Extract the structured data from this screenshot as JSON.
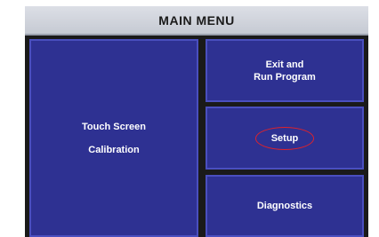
{
  "header": {
    "title": "MAIN MENU"
  },
  "buttons": {
    "calibration": {
      "line1": "Touch Screen",
      "line2": "Calibration"
    },
    "exit_run": {
      "line1": "Exit and",
      "line2": "Run Program"
    },
    "setup": {
      "label": "Setup",
      "highlighted": true
    },
    "diagnostics": {
      "label": "Diagnostics"
    }
  },
  "colors": {
    "button_fill": "#2e3192",
    "button_border": "#4a4fbf",
    "highlight_ring": "#e0222a",
    "titlebar": "#d2d6de"
  }
}
